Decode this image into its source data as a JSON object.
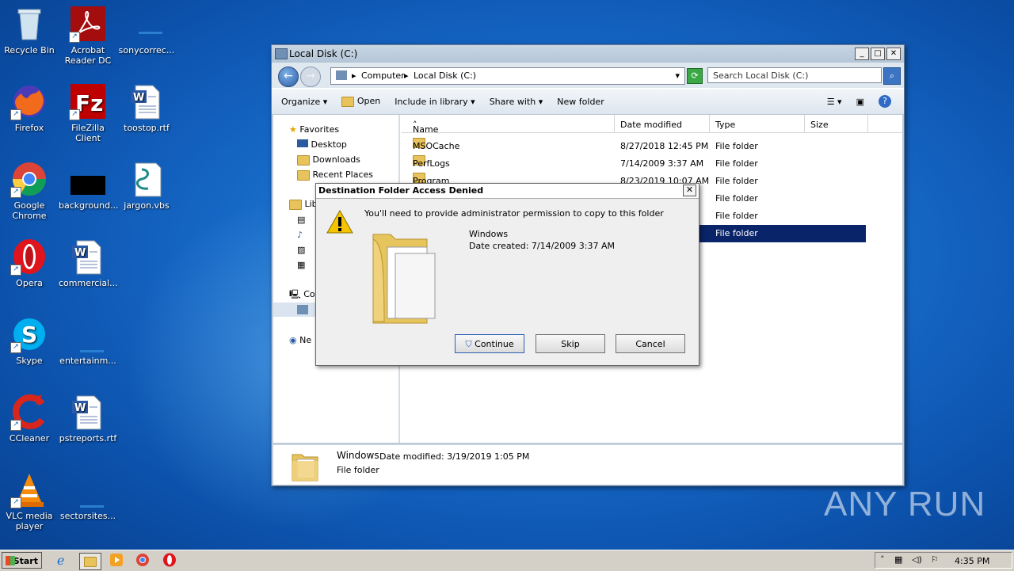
{
  "desktop": {
    "icons": [
      {
        "label": "Recycle Bin"
      },
      {
        "label": "Acrobat Reader DC"
      },
      {
        "label": "sonycorrec..."
      },
      {
        "label": "Firefox"
      },
      {
        "label": "FileZilla Client"
      },
      {
        "label": "toostop.rtf"
      },
      {
        "label": "Google Chrome"
      },
      {
        "label": "background..."
      },
      {
        "label": "jargon.vbs"
      },
      {
        "label": "Opera"
      },
      {
        "label": "commercial..."
      },
      {
        "label": "Skype"
      },
      {
        "label": "entertainm..."
      },
      {
        "label": "CCleaner"
      },
      {
        "label": "pstreports.rtf"
      },
      {
        "label": "VLC media player"
      },
      {
        "label": "sectorsites..."
      }
    ]
  },
  "explorer": {
    "title": "Local Disk (C:)",
    "window_buttons": {
      "minimize": "_",
      "maximize": "□",
      "close": "✕"
    },
    "address": {
      "crumb1": "Computer",
      "crumb2": "Local Disk (C:)"
    },
    "search_placeholder": "Search Local Disk (C:)",
    "toolbar": {
      "organize": "Organize",
      "open": "Open",
      "include": "Include in library",
      "share": "Share with",
      "newfolder": "New folder"
    },
    "nav": {
      "favorites": "Favorites",
      "desktop": "Desktop",
      "downloads": "Downloads",
      "recent": "Recent Places",
      "libraries": "Lib",
      "computer": "Co",
      "network": "Ne"
    },
    "columns": {
      "name": "Name",
      "date": "Date modified",
      "type": "Type",
      "size": "Size"
    },
    "files": [
      {
        "name": "MSOCache",
        "date": "8/27/2018 12:45 PM",
        "type": "File folder"
      },
      {
        "name": "PerfLogs",
        "date": "7/14/2009 3:37 AM",
        "type": "File folder"
      },
      {
        "name": "Program Files",
        "date": "8/23/2019 10:07 AM",
        "type": "File folder"
      },
      {
        "name": "",
        "date": "",
        "type": "File folder"
      },
      {
        "name": "",
        "date": "",
        "type": "File folder"
      },
      {
        "name": "",
        "date": "",
        "type": "File folder"
      }
    ],
    "details": {
      "name": "Windows",
      "modified": "Date modified: 3/19/2019 1:05 PM",
      "kind": "File folder"
    }
  },
  "dialog": {
    "title": "Destination Folder Access Denied",
    "close": "✕",
    "message": "You'll need to provide administrator permission to copy to this folder",
    "folder_name": "Windows",
    "created": "Date created: 7/14/2009 3:37 AM",
    "continue": "Continue",
    "skip": "Skip",
    "cancel": "Cancel"
  },
  "taskbar": {
    "start": "Start",
    "clock": "4:35 PM"
  },
  "watermark": "ANY RUN"
}
